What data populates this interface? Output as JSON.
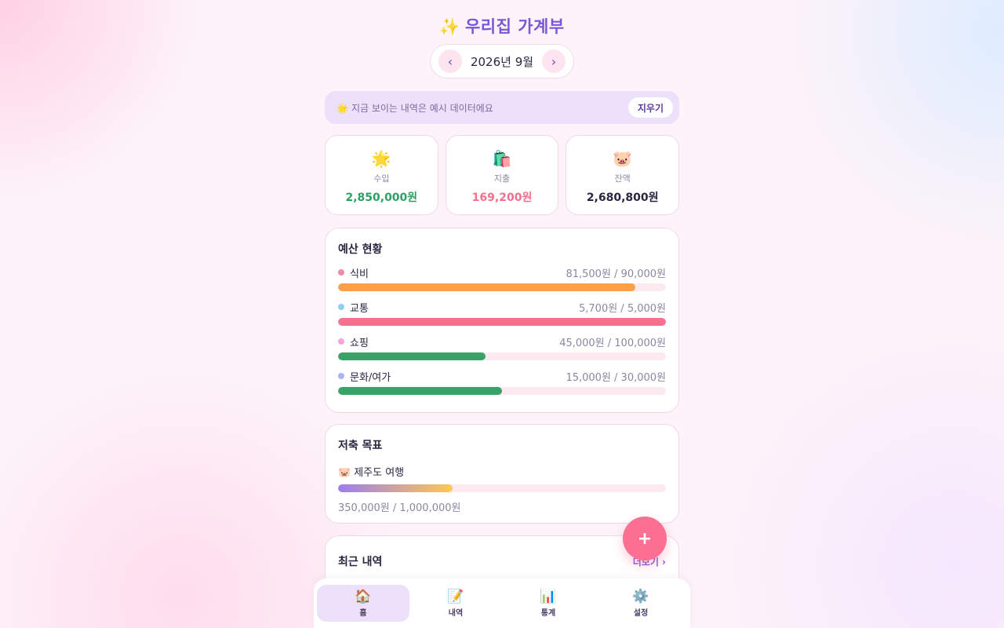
{
  "app": {
    "title": "우리집 가계부",
    "title_icon": "✨"
  },
  "month_nav": {
    "label": "2026년 9월",
    "prev": "‹",
    "next": "›"
  },
  "notice": {
    "icon": "🌟",
    "text": "지금 보이는 내역은 예시 데이터에요",
    "clear_label": "지우기"
  },
  "summary": [
    {
      "icon": "🌟",
      "label": "수입",
      "value": "2,850,000원",
      "color": "#2f9e64"
    },
    {
      "icon": "🛍️",
      "label": "지출",
      "value": "169,200원",
      "color": "#f2708f"
    },
    {
      "icon": "🐷",
      "label": "잔액",
      "value": "2,680,800원",
      "color": "#2b2540"
    }
  ],
  "budget": {
    "title": "예산 현황",
    "items": [
      {
        "name": "식비",
        "amount": "81,500원 / 90,000원",
        "dot": "#f08aa6",
        "bar": "#fba04a",
        "ratio": 0.906
      },
      {
        "name": "교통",
        "amount": "5,700원 / 5,000원",
        "dot": "#8ecff5",
        "bar": "#f7718f",
        "ratio": 1.0
      },
      {
        "name": "쇼핑",
        "amount": "45,000원 / 100,000원",
        "dot": "#f2a4de",
        "bar": "#35a466",
        "ratio": 0.45
      },
      {
        "name": "문화/여가",
        "amount": "15,000원 / 30,000원",
        "dot": "#a8b4f2",
        "bar": "#35a466",
        "ratio": 0.5
      }
    ]
  },
  "savings": {
    "title": "저축 목표",
    "goal_icon": "🐷",
    "goal_name": "제주도 여행",
    "amount": "350,000원 / 1,000,000원",
    "ratio": 0.35
  },
  "recent": {
    "title": "최근 내역",
    "more_label": "더보기 ›"
  },
  "fab": {
    "label": "+"
  },
  "tabs": [
    {
      "icon": "🏠",
      "label": "홈",
      "active": true
    },
    {
      "icon": "📝",
      "label": "내역",
      "active": false
    },
    {
      "icon": "📊",
      "label": "통계",
      "active": false
    },
    {
      "icon": "⚙️",
      "label": "설정",
      "active": false
    }
  ]
}
